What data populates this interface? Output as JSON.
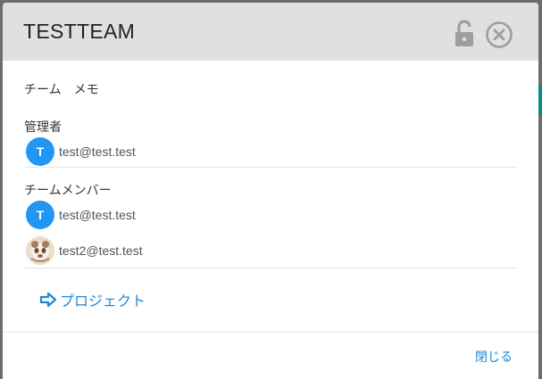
{
  "dialog": {
    "title": "TESTTEAM",
    "memo": "チーム　メモ",
    "admins_label": "管理者",
    "admins": [
      {
        "initial": "T",
        "email": "test@test.test"
      }
    ],
    "members_label": "チームメンバー",
    "members": [
      {
        "initial": "T",
        "email": "test@test.test"
      },
      {
        "initial": "",
        "email": "test2@test.test"
      }
    ],
    "project_link": "プロジェクト",
    "close_label": "閉じる"
  },
  "colors": {
    "accent": "#1e88d6",
    "avatar": "#2196f3",
    "header_bg": "#e0e0e0"
  },
  "icons": {
    "lock": "unlock-icon",
    "close": "close-circle-icon",
    "project": "arrow-right-icon"
  }
}
